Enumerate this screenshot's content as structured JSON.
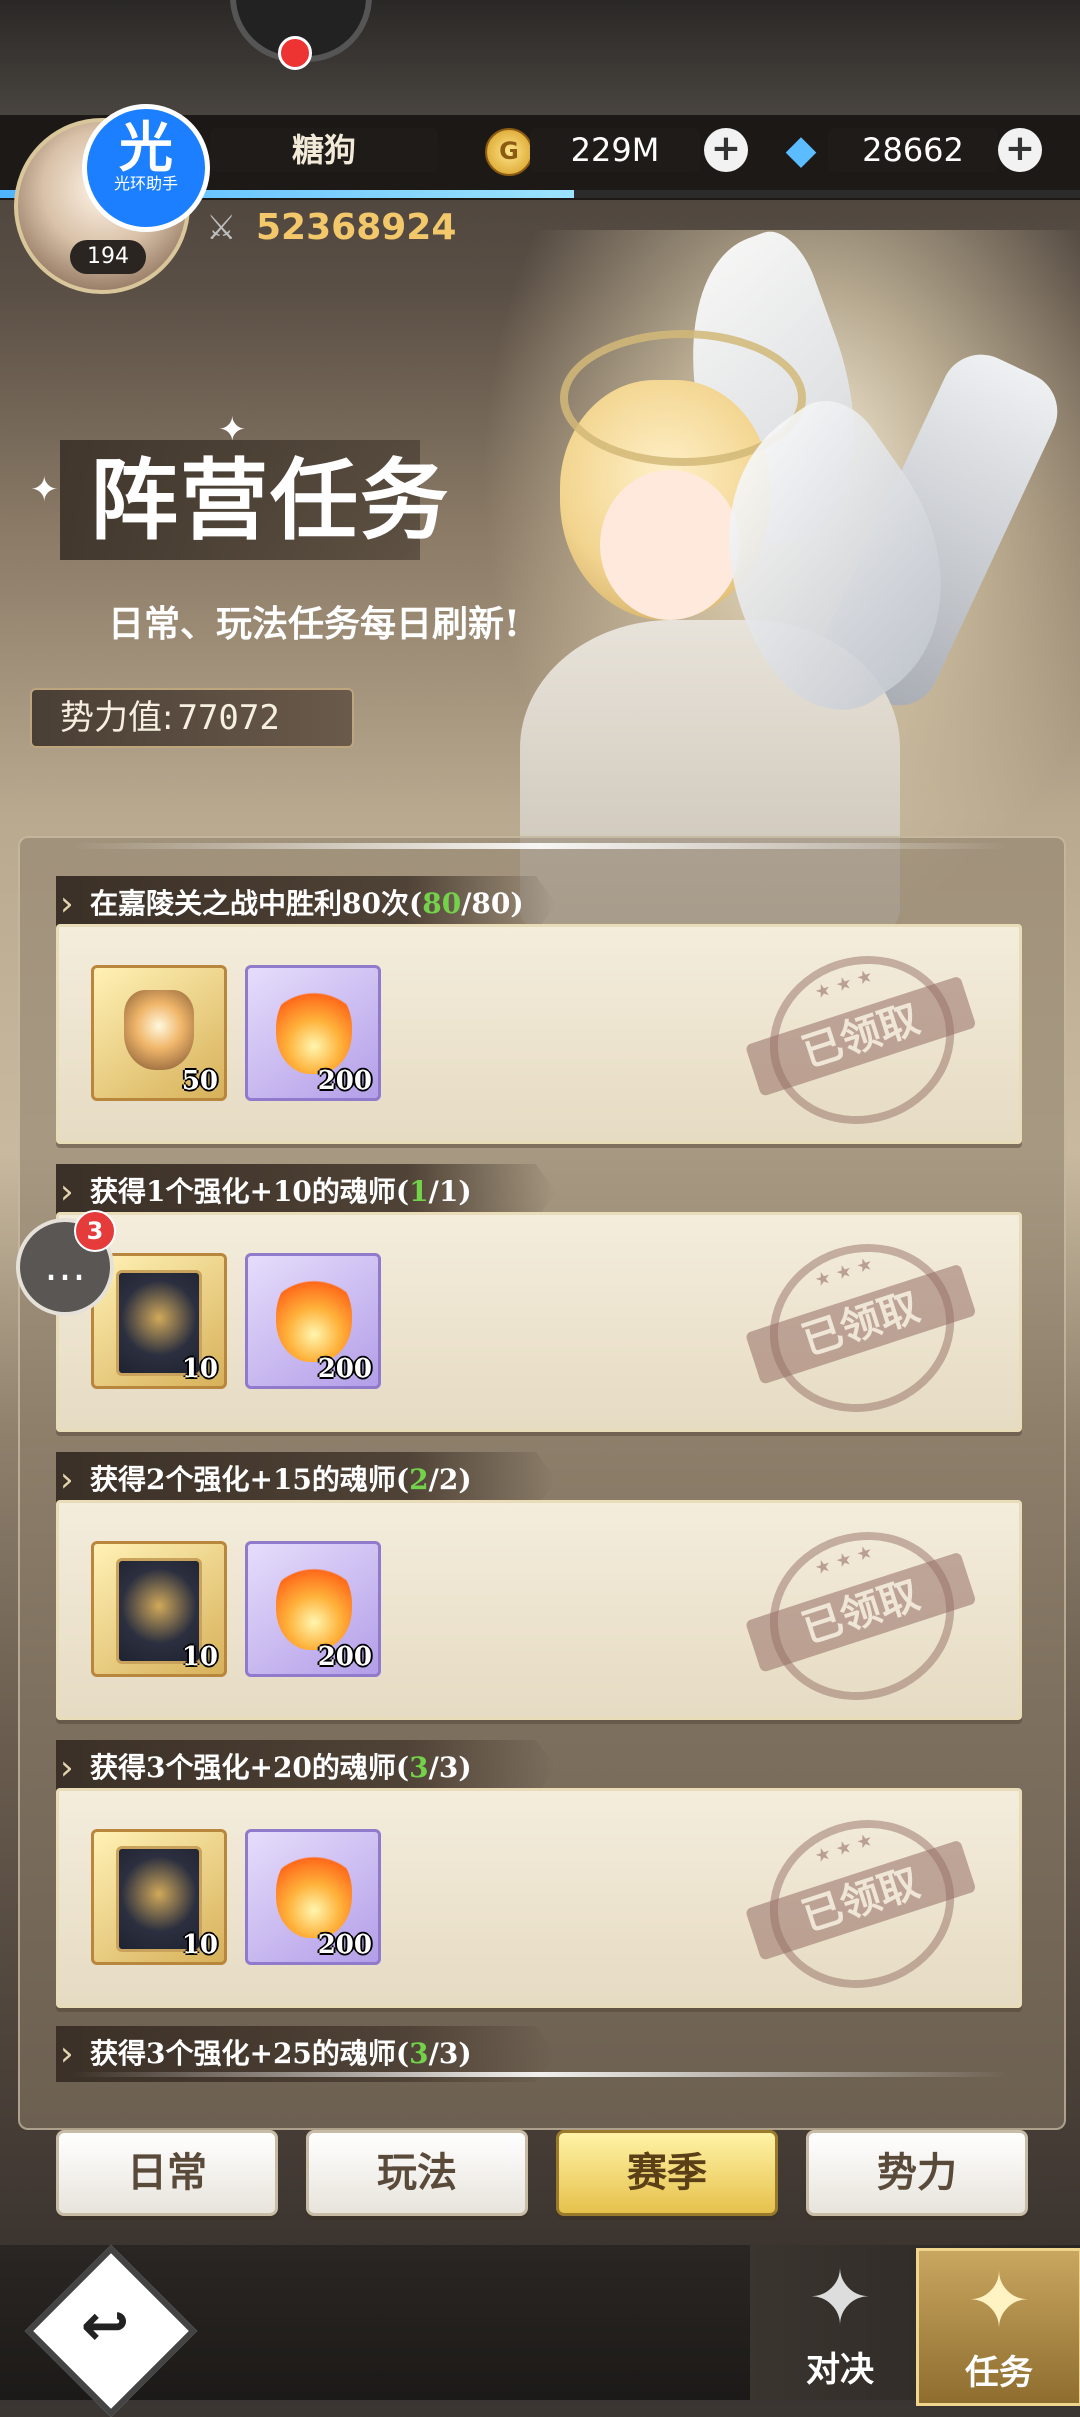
{
  "player": {
    "name": "糖狗",
    "level": "194",
    "assistant_badge_big": "光",
    "assistant_badge_small": "光环助手",
    "gold": "229M",
    "diamonds": "28662",
    "combat_power": "52368924"
  },
  "banner": {
    "title": "阵营任务",
    "subtitle": "日常、玩法任务每日刷新!",
    "influence_label": "势力值:",
    "influence_value": "77072"
  },
  "tasks": [
    {
      "title_prefix": "在嘉陵关之战中胜利80次(",
      "progress_current": "80",
      "progress_sep_total": "/80)",
      "rewards": [
        {
          "icon": "pendant-icon",
          "qty": "50",
          "style": "gold"
        },
        {
          "icon": "flame-icon",
          "qty": "200",
          "style": "purple"
        }
      ],
      "stamp": "已领取",
      "stamp_stars": "★ ★ ★"
    },
    {
      "title_prefix": "获得1个强化+10的魂师(",
      "progress_current": "1",
      "progress_sep_total": "/1)",
      "rewards": [
        {
          "icon": "soul-card-icon",
          "qty": "10",
          "style": "gold"
        },
        {
          "icon": "flame-icon",
          "qty": "200",
          "style": "purple"
        }
      ],
      "stamp": "已领取",
      "stamp_stars": "★ ★ ★"
    },
    {
      "title_prefix": "获得2个强化+15的魂师(",
      "progress_current": "2",
      "progress_sep_total": "/2)",
      "rewards": [
        {
          "icon": "soul-card-icon",
          "qty": "10",
          "style": "gold"
        },
        {
          "icon": "flame-icon",
          "qty": "200",
          "style": "purple"
        }
      ],
      "stamp": "已领取",
      "stamp_stars": "★ ★ ★"
    },
    {
      "title_prefix": "获得3个强化+20的魂师(",
      "progress_current": "3",
      "progress_sep_total": "/3)",
      "rewards": [
        {
          "icon": "soul-card-icon",
          "qty": "10",
          "style": "gold"
        },
        {
          "icon": "flame-icon",
          "qty": "200",
          "style": "purple"
        }
      ],
      "stamp": "已领取",
      "stamp_stars": "★ ★ ★"
    },
    {
      "title_prefix": "获得3个强化+25的魂师(",
      "progress_current": "3",
      "progress_sep_total": "/3)"
    }
  ],
  "tabs": [
    {
      "label": "日常",
      "active": false
    },
    {
      "label": "玩法",
      "active": false
    },
    {
      "label": "赛季",
      "active": true
    },
    {
      "label": "势力",
      "active": false
    }
  ],
  "nav": {
    "duel_label": "对决",
    "tasks_label": "任务"
  },
  "chat": {
    "unread": "3"
  },
  "colors": {
    "progress_green": "#73d24a",
    "active_tab": "#e6c14c",
    "xp_bar": "#4fb4ff"
  }
}
